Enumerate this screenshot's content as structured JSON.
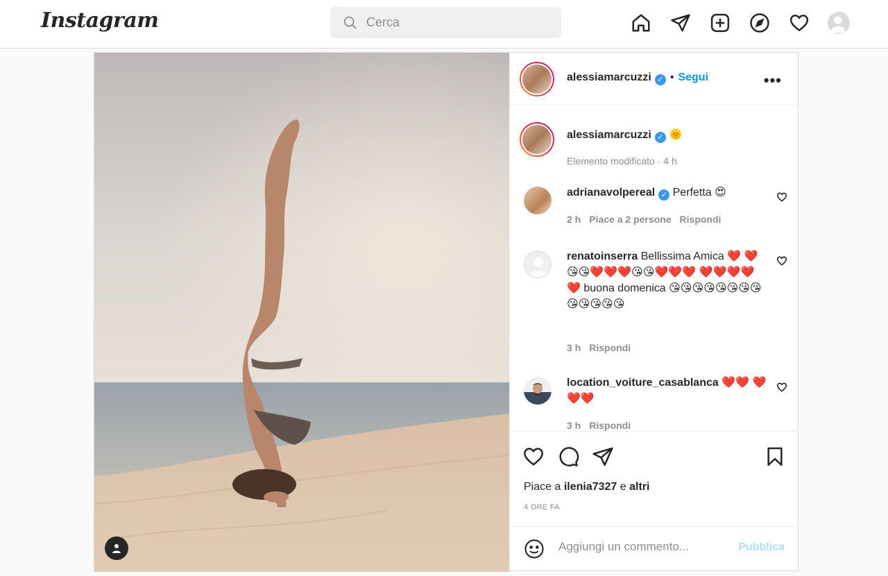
{
  "brand": {
    "logo_text": "Instagram"
  },
  "search": {
    "placeholder": "Cerca"
  },
  "nav": {
    "icons": [
      "home-icon",
      "direct-icon",
      "new-post-icon",
      "explore-icon",
      "activity-icon",
      "profile-avatar"
    ]
  },
  "post": {
    "author": "alessiamarcuzzi",
    "follow_label": "Segui",
    "more_label": "•••",
    "caption": {
      "username": "alessiamarcuzzi",
      "emoji": "🌞",
      "meta": "Elemento modificato · 4 h"
    },
    "comments": [
      {
        "username": "adrianavolpereal",
        "verified": true,
        "text": "Perfetta 😍",
        "time": "2 h",
        "likes": "Piace a 2 persone",
        "reply": "Rispondi"
      },
      {
        "username": "renatoinserra",
        "verified": false,
        "text": "Bellissima Amica ❤️ ❤️😘😘❤️❤️❤️😘😘❤️❤️❤️ ❤️❤️❤️❤️❤️ buona domenica 😘😘😘😘😘😘😘😘😘😘😘😘😘",
        "time": "3 h",
        "reply": "Rispondi"
      },
      {
        "username": "location_voiture_casablanca",
        "verified": false,
        "text": "❤️❤️ ❤️❤️❤️",
        "time": "3 h",
        "reply": "Rispondi"
      }
    ],
    "likes_prefix": "Piace a",
    "likes_user": "ilenia7327",
    "likes_joiner": "e",
    "likes_others": "altri",
    "timestamp": "4 ORE FA",
    "comment_placeholder": "Aggiungi un commento...",
    "publish_label": "Pubblica"
  },
  "colors": {
    "accent": "#0095f6",
    "publish_disabled": "#b2dffc",
    "border": "#dbdbdb",
    "background": "#fafafa"
  }
}
